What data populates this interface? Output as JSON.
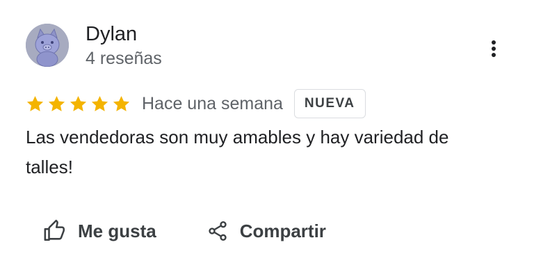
{
  "author": {
    "name": "Dylan",
    "meta": "4 reseñas",
    "avatar_icon": "pig-avatar-icon"
  },
  "review": {
    "rating": 5,
    "max_rating": 5,
    "date": "Hace una semana",
    "badge": "NUEVA",
    "text": "Las vendedoras son muy amables y hay variedad de talles!"
  },
  "actions": {
    "like_label": "Me gusta",
    "share_label": "Compartir"
  },
  "colors": {
    "star": "#f4b400",
    "text": "#202124",
    "secondary": "#5f6368"
  }
}
